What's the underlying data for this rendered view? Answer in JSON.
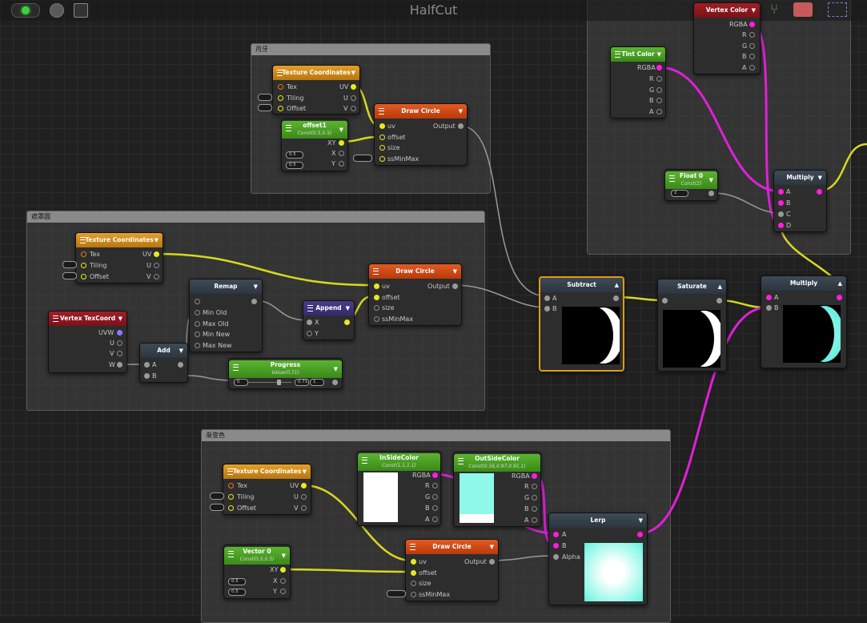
{
  "window": {
    "title": "HalfCut"
  },
  "groups": {
    "moon": "月牙",
    "mask": "遮罩圆",
    "gradient": "渐变色"
  },
  "common": {
    "tex": "Tex",
    "tiling": "Tiling",
    "offset": "Offset",
    "uv": "UV",
    "u": "U",
    "v": "V",
    "w": "W",
    "uv_in": "uv",
    "offset_in": "offset",
    "size": "size",
    "ssminmax": "ssMinMax",
    "output": "Output",
    "rgba": "RGBA",
    "r": "R",
    "g": "G",
    "b": "B",
    "a": "A",
    "ia": "A",
    "ib": "B",
    "ic": "C",
    "id": "D",
    "x": "X",
    "y": "Y",
    "xy": "XY",
    "uvw": "UVW",
    "alpha": "Alpha"
  },
  "nodes": {
    "texcoord": "Texture Coordinates",
    "drawcircle": "Draw Circle",
    "offset1": {
      "title": "offset1",
      "sub": "Const(0.5,0.5)",
      "x": "0.5",
      "y": "0.5"
    },
    "remap": {
      "title": "Remap",
      "min_old": "Min Old",
      "max_old": "Max Old",
      "min_new": "Min New",
      "max_new": "Max New"
    },
    "append": "Append",
    "vertex_texcoord": "Vertex TexCoord",
    "add": "Add",
    "progress": {
      "title": "Progress",
      "sub": "Value(0.71)",
      "min": "0",
      "value": "0.71",
      "max": "1"
    },
    "tint": "Tint Color",
    "vertex_color": "Vertex Color",
    "float0": {
      "title": "Float 0",
      "sub": "Const(2)",
      "value": "2"
    },
    "multiply": "Multiply",
    "subtract": "Subtract",
    "saturate": "Saturate",
    "inside": {
      "title": "InSideColor",
      "sub": "Const(1,1,1,1)"
    },
    "outside": {
      "title": "OutSideColor",
      "sub": "Const(0.56,0.97,0.91,1)"
    },
    "lerp": "Lerp",
    "vector0": {
      "title": "Vector 0",
      "sub": "Const(0.5,0.5)",
      "x": "0.5",
      "y": "0.5"
    }
  },
  "colors": {
    "selected_border": "#e09b14",
    "wire_yellow": "#d8d820",
    "wire_magenta": "#e020d8",
    "wire_gray": "#9a9a9a",
    "outside_color": "#8ff8e8"
  }
}
